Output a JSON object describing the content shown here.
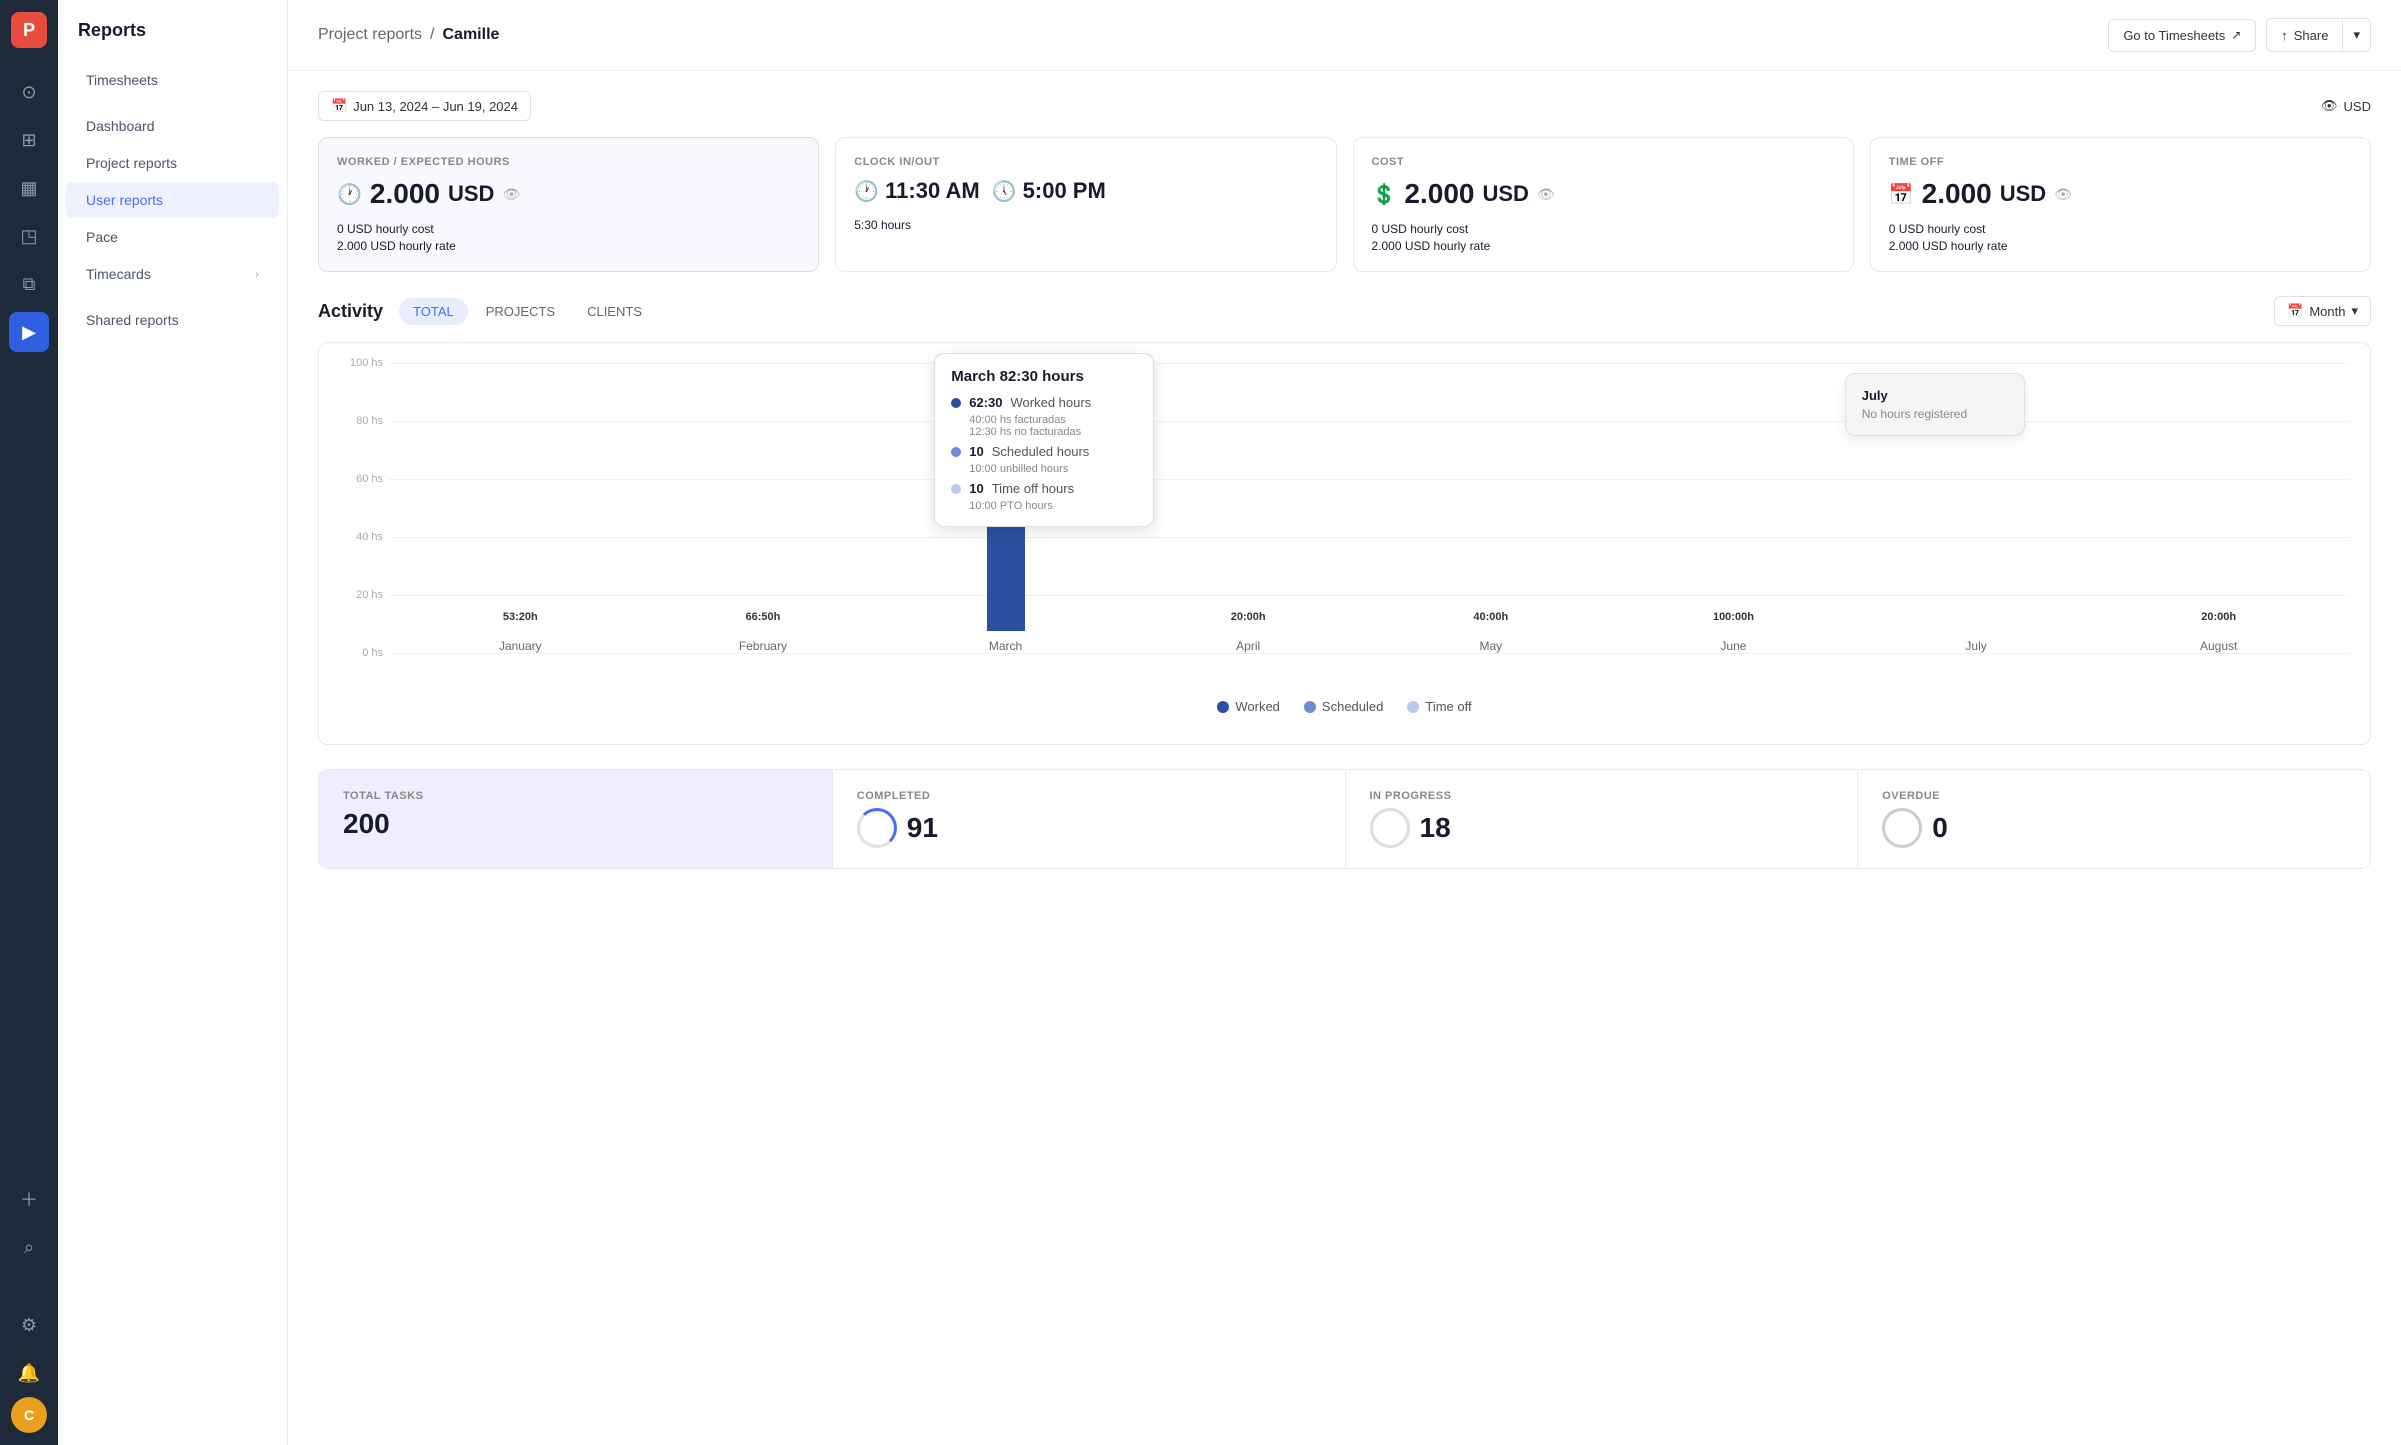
{
  "sidebar": {
    "logo": "P",
    "nav_items": [
      {
        "id": "timesheets",
        "icon": "⊙",
        "label": "timesheets"
      },
      {
        "id": "folder",
        "icon": "◫",
        "label": "folder"
      },
      {
        "id": "chart",
        "icon": "▦",
        "label": "chart"
      },
      {
        "id": "ruler",
        "icon": "⊿",
        "label": "ruler"
      },
      {
        "id": "clipboard",
        "icon": "⧉",
        "label": "clipboard"
      }
    ],
    "play_btn": "▶",
    "plus_icon": "+",
    "search_icon": "⌕",
    "settings_icon": "⚙",
    "notification_icon": "🔔",
    "avatar": "C"
  },
  "left_panel": {
    "title": "Reports",
    "items": [
      {
        "label": "Timesheets",
        "active": false
      },
      {
        "label": "Dashboard",
        "active": false
      },
      {
        "label": "Project reports",
        "active": false
      },
      {
        "label": "User reports",
        "active": true
      },
      {
        "label": "Pace",
        "active": false
      },
      {
        "label": "Timecards",
        "active": false,
        "arrow": true
      },
      {
        "label": "Shared reports",
        "active": false
      }
    ]
  },
  "header": {
    "breadcrumb_root": "Project reports",
    "breadcrumb_separator": "/",
    "breadcrumb_current": "Camille",
    "goto_label": "Go to Timesheets",
    "share_label": "Share"
  },
  "date_filter": {
    "icon": "📅",
    "range": "Jun 13, 2024 – Jun 19, 2024"
  },
  "currency": {
    "icon": "👁",
    "label": "USD"
  },
  "stats": {
    "worked": {
      "label": "WORKED / EXPECTED HOURS",
      "value": "2.000",
      "currency": "USD",
      "sub1_value": "0 USD",
      "sub1_label": "hourly cost",
      "sub2_value": "2.000 USD",
      "sub2_label": "hourly rate"
    },
    "clock": {
      "label": "CLOCK IN/OUT",
      "in_time": "11:30 AM",
      "out_time": "5:00 PM",
      "hours": "5:30",
      "hours_label": "hours"
    },
    "cost": {
      "label": "COST",
      "value": "2.000",
      "currency": "USD",
      "sub1_value": "0 USD",
      "sub1_label": "hourly cost",
      "sub2_value": "2.000 USD",
      "sub2_label": "hourly rate"
    },
    "time_off": {
      "label": "TIME OFF",
      "value": "2.000",
      "currency": "USD",
      "sub1_value": "0 USD",
      "sub1_label": "hourly cost",
      "sub2_value": "2.000 USD",
      "sub2_label": "hourly rate"
    }
  },
  "activity": {
    "title": "Activity",
    "tabs": [
      {
        "label": "TOTAL",
        "active": true
      },
      {
        "label": "PROJECTS",
        "active": false
      },
      {
        "label": "CLIENTS",
        "active": false
      }
    ],
    "filter_icon": "📅",
    "filter_label": "Month",
    "filter_arrow": "▾"
  },
  "chart": {
    "y_labels": [
      "100 hs",
      "80 hs",
      "60 hs",
      "40 hs",
      "20 hs",
      "0 hs"
    ],
    "months": [
      {
        "name": "January",
        "worked": 53,
        "worked_label": "53:20h",
        "scheduled": 0,
        "time_off": 0
      },
      {
        "name": "February",
        "worked": 67,
        "worked_label": "66:50h",
        "scheduled": 0,
        "time_off": 0
      },
      {
        "name": "March",
        "worked": 62,
        "worked_label": "62:30h",
        "scheduled": 10,
        "scheduled_label": "10:00h",
        "time_off": 10,
        "time_off_label": "10:00h",
        "tooltip": true
      },
      {
        "name": "April",
        "worked": 20,
        "worked_label": "20:00h",
        "scheduled": 0,
        "time_off": 0
      },
      {
        "name": "May",
        "worked": 40,
        "worked_label": "40:00h",
        "scheduled": 0,
        "time_off": 0
      },
      {
        "name": "June",
        "worked": 100,
        "worked_label": "100:00h",
        "scheduled": 0,
        "time_off": 0
      },
      {
        "name": "July",
        "worked": 0,
        "scheduled": 0,
        "time_off": 0,
        "july_tooltip": true
      },
      {
        "name": "August",
        "worked": 20,
        "worked_label": "20:00h",
        "scheduled": 0,
        "time_off": 0,
        "gray": true
      }
    ],
    "legend": [
      {
        "label": "Worked",
        "color": "#2d4fa0"
      },
      {
        "label": "Scheduled",
        "color": "#6b8dd6"
      },
      {
        "label": "Time off",
        "color": "#b8c8ee"
      }
    ]
  },
  "tooltip": {
    "title": "March 82:30 hours",
    "worked_value": "62:30",
    "worked_label": "Worked hours",
    "worked_sub1": "40:00 hs facturadas",
    "worked_sub2": "12:30 hs no facturadas",
    "scheduled_value": "10",
    "scheduled_label": "Scheduled hours",
    "scheduled_sub": "10:00 unbilled hours",
    "time_off_value": "10",
    "time_off_label": "Time off hours",
    "time_off_sub": "10:00 PTO hours"
  },
  "july_tooltip": {
    "title": "July",
    "sub": "No hours registered"
  },
  "bottom_stats": {
    "total_tasks_label": "TOTAL TASKS",
    "total_tasks_value": "200",
    "completed_label": "COMPLETED",
    "completed_value": "91",
    "in_progress_label": "IN PROGRESS",
    "in_progress_value": "18",
    "overdue_label": "OVERDUE",
    "overdue_value": "0"
  }
}
